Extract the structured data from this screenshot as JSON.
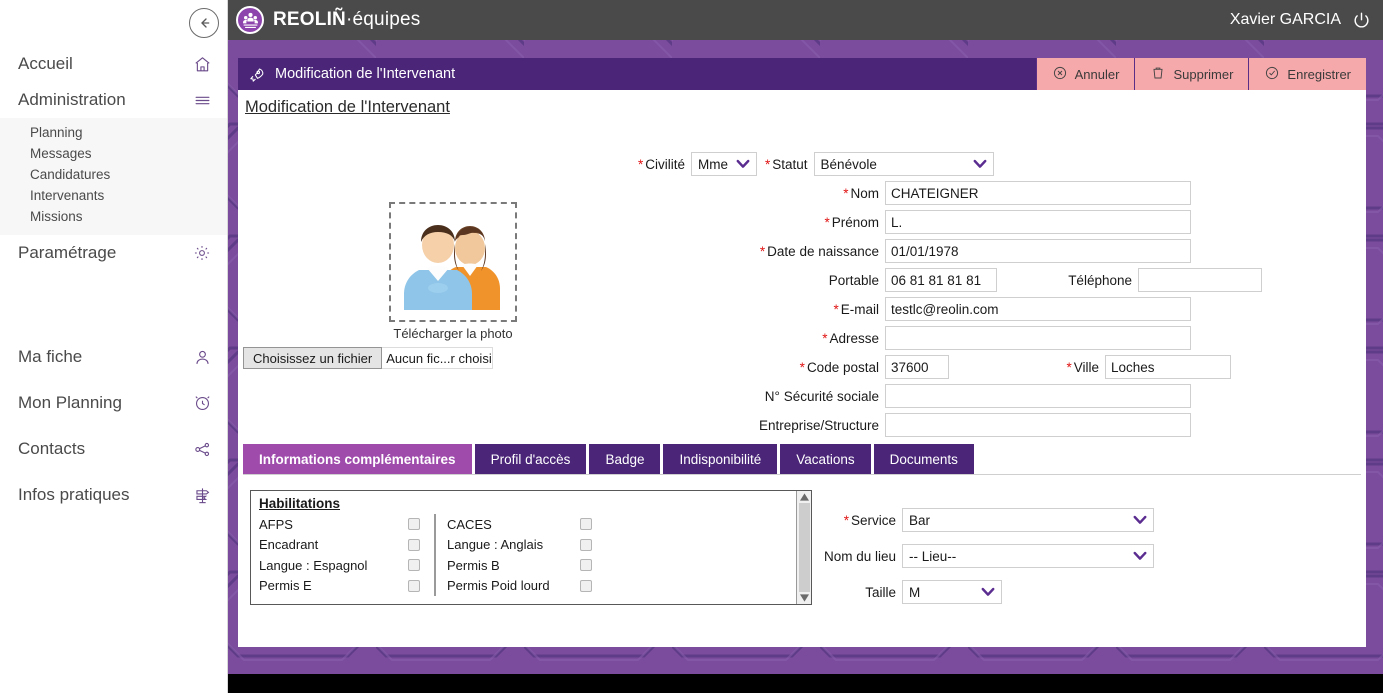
{
  "app": {
    "brand_main": "REOLIÑ",
    "brand_sep": "·",
    "brand_sub": "équipes",
    "user": "Xavier GARCIA",
    "logo_icon": "people-group-icon",
    "power_icon": "power-icon"
  },
  "sidebar": {
    "collapse_icon": "arrow-left-circle-icon",
    "items": [
      {
        "label": "Accueil",
        "icon": "home-icon"
      },
      {
        "label": "Administration",
        "icon": "hamburger-icon"
      },
      {
        "label": "Paramétrage",
        "icon": "gear-icon"
      },
      {
        "label": "Ma fiche",
        "icon": "user-icon"
      },
      {
        "label": "Mon Planning",
        "icon": "clock-icon"
      },
      {
        "label": "Contacts",
        "icon": "share-nodes-icon"
      },
      {
        "label": "Infos pratiques",
        "icon": "signpost-icon"
      }
    ],
    "submenu": [
      {
        "label": "Planning"
      },
      {
        "label": "Messages"
      },
      {
        "label": "Candidatures"
      },
      {
        "label": "Intervenants"
      },
      {
        "label": "Missions"
      }
    ]
  },
  "card": {
    "bar_title": "Modification de l'Intervenant",
    "bar_icon": "rocket-icon",
    "page_title": "Modification de l'Intervenant",
    "actions": [
      {
        "label": "Annuler",
        "icon": "cancel-circle-icon"
      },
      {
        "label": "Supprimer",
        "icon": "trash-icon"
      },
      {
        "label": "Enregistrer",
        "icon": "check-circle-icon"
      }
    ]
  },
  "photo": {
    "caption": "Télécharger la photo",
    "file_button": "Choisissez un fichier",
    "file_status": "Aucun fic...r choisi",
    "placeholder_icon": "two-people-avatar-icon"
  },
  "form": {
    "civilite": {
      "label": "Civilité",
      "value": "Mme",
      "required": true
    },
    "statut": {
      "label": "Statut",
      "value": "Bénévole",
      "required": true
    },
    "nom": {
      "label": "Nom",
      "value": "CHATEIGNER",
      "required": true
    },
    "prenom": {
      "label": "Prénom",
      "value": "L.",
      "required": true
    },
    "naissance": {
      "label": "Date de naissance",
      "value": "01/01/1978",
      "required": true
    },
    "portable": {
      "label": "Portable",
      "value": "06 81 81 81 81",
      "required": false
    },
    "telephone": {
      "label": "Téléphone",
      "value": "",
      "required": false
    },
    "email": {
      "label": "E-mail",
      "value": "testlc@reolin.com",
      "required": true
    },
    "adresse": {
      "label": "Adresse",
      "value": "",
      "required": true
    },
    "code_postal": {
      "label": "Code postal",
      "value": "37600",
      "required": true
    },
    "ville": {
      "label": "Ville",
      "value": "Loches",
      "required": true
    },
    "secu": {
      "label": "N° Sécurité sociale",
      "value": "",
      "required": false
    },
    "entreprise": {
      "label": "Entreprise/Structure",
      "value": "",
      "required": false
    }
  },
  "tabs": [
    {
      "label": "Informations complémentaires",
      "active": true
    },
    {
      "label": "Profil d'accès",
      "active": false
    },
    {
      "label": "Badge",
      "active": false
    },
    {
      "label": "Indisponibilité",
      "active": false
    },
    {
      "label": "Vacations",
      "active": false
    },
    {
      "label": "Documents",
      "active": false
    }
  ],
  "panel": {
    "habilitations_title": "Habilitations",
    "column_left": [
      {
        "label": "AFPS",
        "checked": false
      },
      {
        "label": "Encadrant",
        "checked": false
      },
      {
        "label": "Langue : Espagnol",
        "checked": false
      },
      {
        "label": "Permis E",
        "checked": false
      }
    ],
    "column_right": [
      {
        "label": "CACES",
        "checked": false
      },
      {
        "label": "Langue : Anglais",
        "checked": false
      },
      {
        "label": "Permis B",
        "checked": false
      },
      {
        "label": "Permis Poid lourd",
        "checked": false
      }
    ],
    "service": {
      "label": "Service",
      "value": "Bar",
      "required": true
    },
    "lieu": {
      "label": "Nom du lieu",
      "value": "-- Lieu--",
      "required": false
    },
    "taille": {
      "label": "Taille",
      "value": "M",
      "required": false
    }
  },
  "colors": {
    "brand_purple": "#4a2578",
    "tab_active": "#9e4bab",
    "backdrop": "#7b4c9e",
    "header_gray": "#4a4a4a",
    "action_pink": "#f6a9ab",
    "required_red": "#e11414",
    "chevron_purple": "#5b2d91"
  }
}
